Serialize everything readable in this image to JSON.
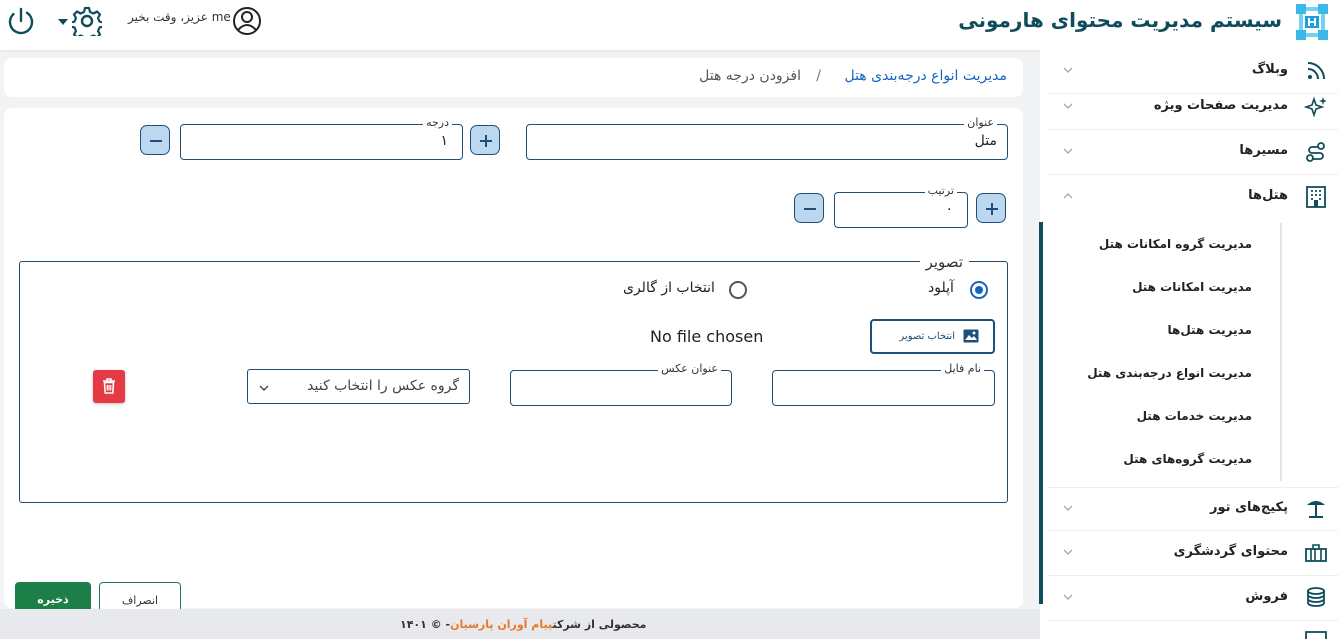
{
  "header": {
    "brand_title": "سیستم مدیریت محتوای هارمونی",
    "greeting": "me عزیز، وقت بخیر"
  },
  "sidebar": {
    "items": [
      {
        "label": "وبلاگ",
        "icon": "rss-icon",
        "expanded": false
      },
      {
        "label": "مدیریت صفحات ویژه",
        "icon": "sparkles-icon",
        "expanded": false
      },
      {
        "label": "مسیرها",
        "icon": "route-icon",
        "expanded": false
      },
      {
        "label": "هتل‌ها",
        "icon": "building-icon",
        "expanded": true
      },
      {
        "label": "پکیج‌های تور",
        "icon": "beach-umbrella-icon",
        "expanded": false
      },
      {
        "label": "محتوای گردشگری",
        "icon": "luggage-icon",
        "expanded": false
      },
      {
        "label": "فروش",
        "icon": "coins-icon",
        "expanded": false
      }
    ],
    "hotel_submenu": [
      "مدیریت گروه امکانات هتل",
      "مدیریت امکانات هتل",
      "مدیریت هتل‌ها",
      "مدیریت انواع درجه‌بندی هتل",
      "مدیریت خدمات هتل",
      "مدیریت گروه‌های هتل"
    ]
  },
  "breadcrumb": {
    "parent": "مدیریت انواع درجه‌بندی هتل",
    "separator": "/",
    "current": "افزودن درجه هتل"
  },
  "form": {
    "title_label": "عنوان",
    "title_value": "متل",
    "grade_label": "درجه",
    "grade_value": "۱",
    "order_label": "ترتیب",
    "order_value": "۰",
    "image_legend": "تصویر",
    "radio_upload": "آپلود",
    "radio_gallery": "انتخاب از گالری",
    "choose_image_button": "انتخاب تصویر",
    "no_file": "No file chosen",
    "file_name_label": "نام فایل",
    "file_name_value": "",
    "image_title_label": "عنوان عکس",
    "image_title_value": "",
    "photo_group_placeholder": "گروه عکس را انتخاب کنید",
    "save_button": "ذخیره",
    "cancel_button": "انصراف"
  },
  "footer": {
    "prefix": "محصولی از شرکت",
    "company": "پیام آوران پارسیان",
    "suffix": "- © ۱۴۰۱"
  },
  "colors": {
    "brand": "#0f4c5c",
    "primary": "#1565c0",
    "border": "#1f4e79",
    "save": "#1b7f47",
    "danger": "#e63946",
    "footer_company": "#e8772e"
  }
}
